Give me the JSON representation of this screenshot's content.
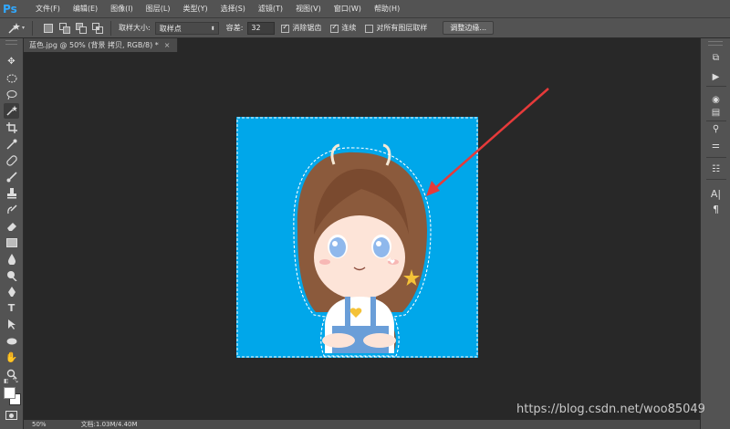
{
  "app": {
    "logo": "Ps"
  },
  "menu": [
    "文件(F)",
    "编辑(E)",
    "图像(I)",
    "图层(L)",
    "类型(Y)",
    "选择(S)",
    "滤镜(T)",
    "视图(V)",
    "窗口(W)",
    "帮助(H)"
  ],
  "options": {
    "sample_size_label": "取样大小:",
    "sample_size_value": "取样点",
    "tolerance_label": "容差:",
    "tolerance_value": "32",
    "antialias_label": "消除锯齿",
    "contiguous_label": "连续",
    "sample_all_layers_label": "对所有图层取样",
    "refine_edge_label": "调整边缘..."
  },
  "document": {
    "tab_title": "蓝色.jpg @ 50% (背景 拷贝, RGB/8) *"
  },
  "status": {
    "zoom": "50%",
    "doc_info": "文档:1.03M/4.40M"
  },
  "watermark": "https://blog.csdn.net/woo85049",
  "colors": {
    "canvas_bg": "#00a7ea",
    "arrow": "#e63a3a",
    "ps_blue": "#31a8ff"
  },
  "icons": [
    "magic-wand-icon",
    "move-icon",
    "marquee-icon",
    "lasso-icon",
    "crop-icon",
    "eyedropper-icon",
    "healing-icon",
    "brush-icon",
    "stamp-icon",
    "history-brush-icon",
    "eraser-icon",
    "gradient-icon",
    "blur-icon",
    "dodge-icon",
    "pen-icon",
    "type-icon",
    "path-select-icon",
    "shape-icon",
    "hand-icon",
    "zoom-icon"
  ]
}
